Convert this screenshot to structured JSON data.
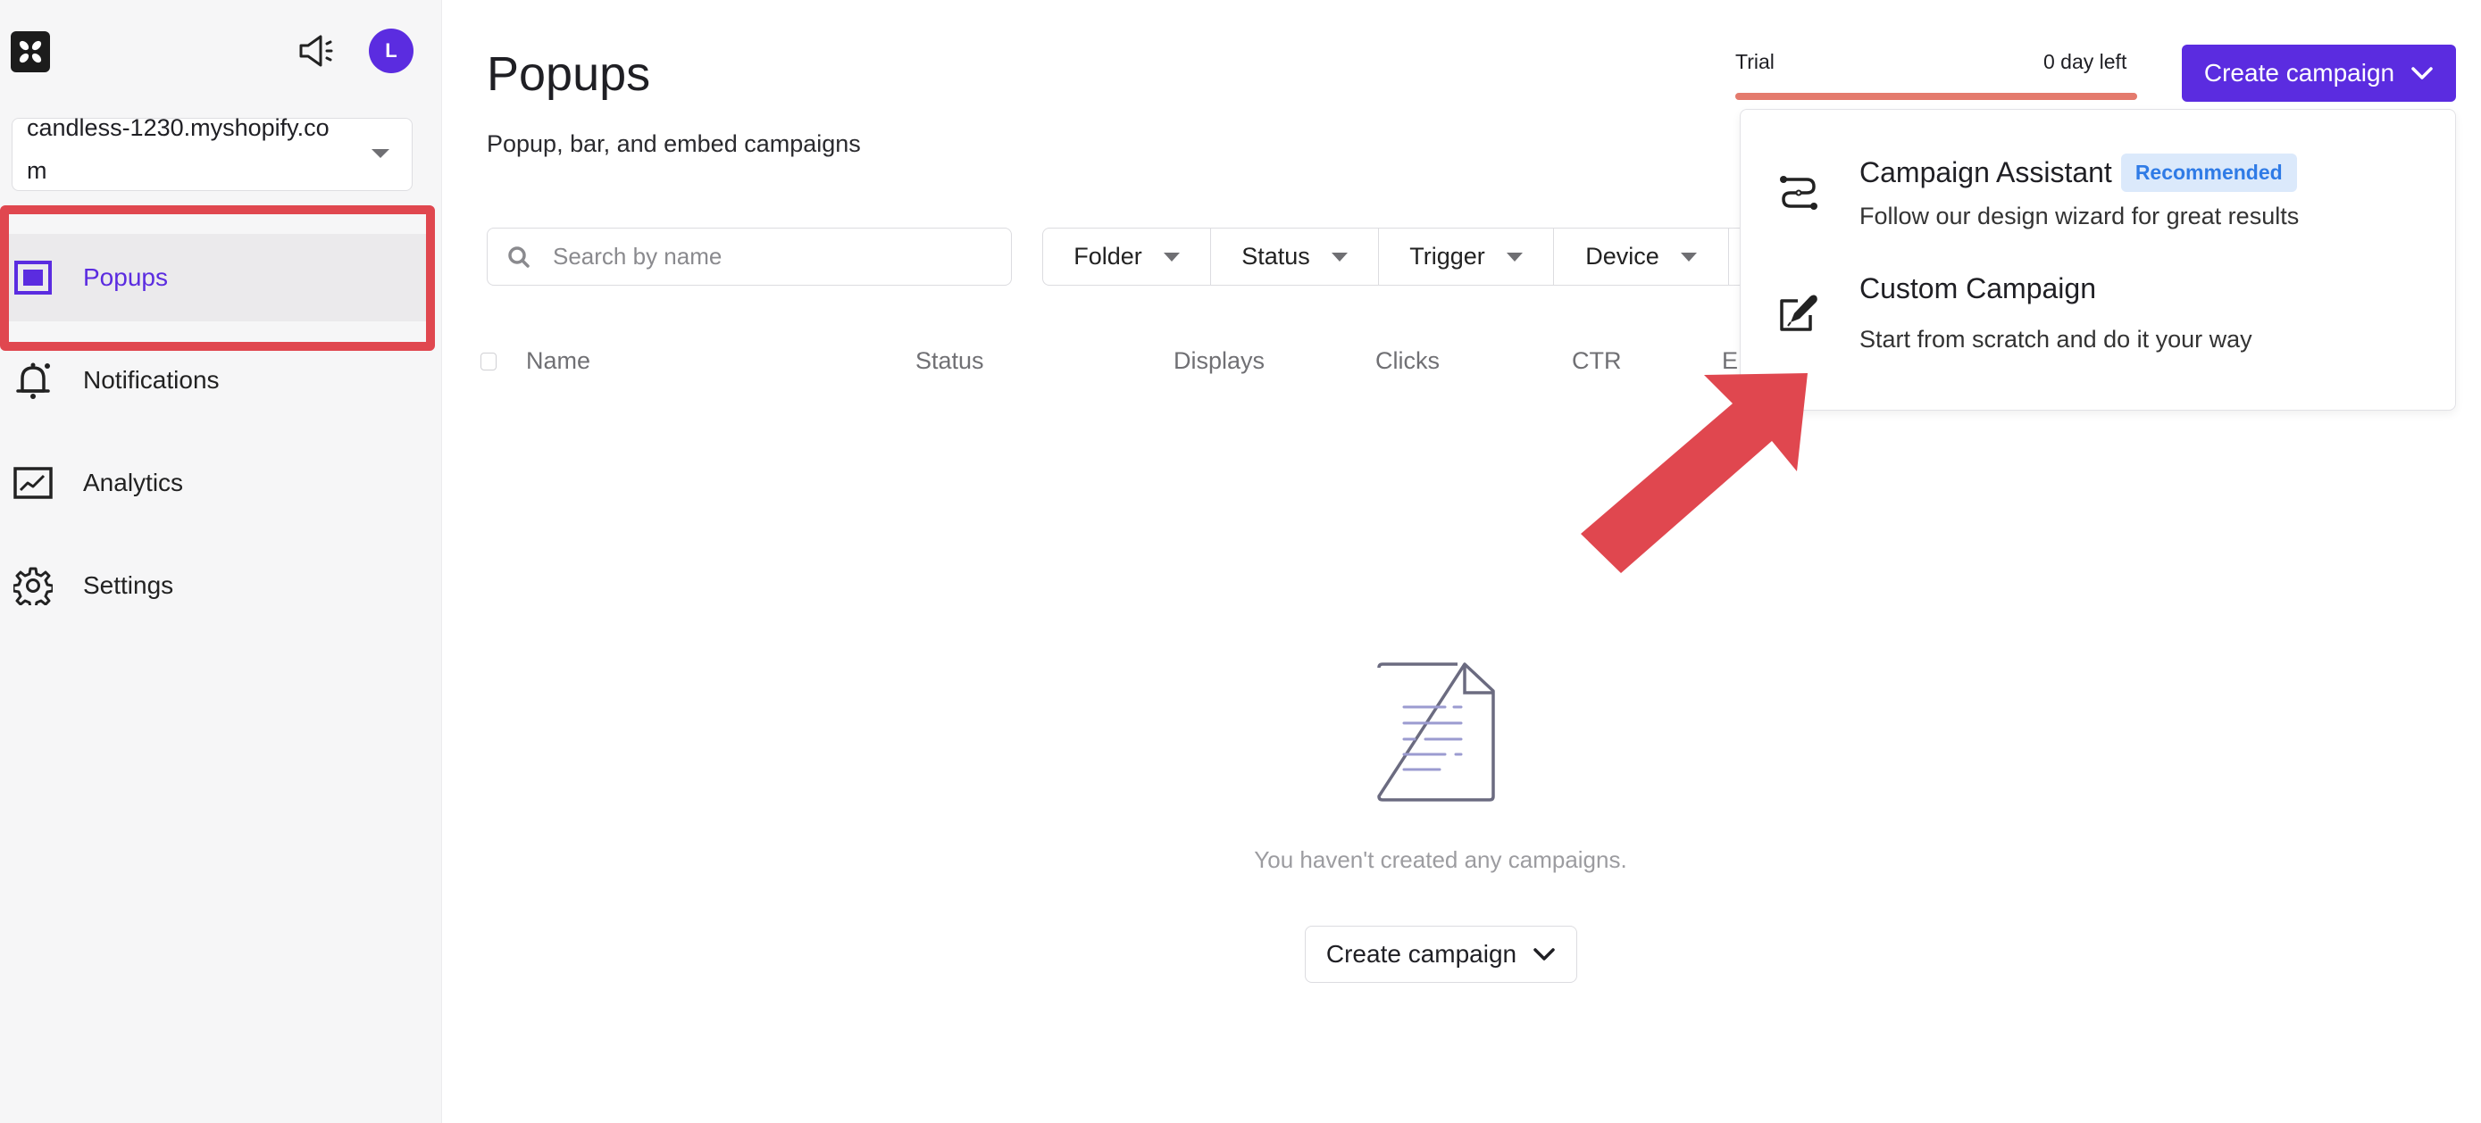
{
  "sidebar": {
    "logo_icon": "brand-logo-icon",
    "announcements_icon": "megaphone-icon",
    "avatar_initial": "L",
    "store_select": {
      "value": "candless-1230.myshopify.com",
      "icon": "caret-down-icon"
    },
    "items": [
      {
        "label": "Popups",
        "icon": "popup-window-icon",
        "active": true
      },
      {
        "label": "Notifications",
        "icon": "bell-icon",
        "active": false
      },
      {
        "label": "Analytics",
        "icon": "chart-line-icon",
        "active": false
      },
      {
        "label": "Settings",
        "icon": "gear-icon",
        "active": false
      }
    ]
  },
  "header": {
    "title": "Popups",
    "subtitle": "Popup, bar, and embed campaigns",
    "trial": {
      "label": "Trial",
      "remaining": "0 day left",
      "progress_fraction": 1.0
    },
    "create_button": {
      "label": "Create campaign",
      "icon": "chevron-down-icon"
    }
  },
  "toolbar": {
    "search": {
      "placeholder": "Search by name",
      "value": "",
      "icon": "search-icon"
    },
    "filters": [
      {
        "label": "Folder"
      },
      {
        "label": "Status"
      },
      {
        "label": "Trigger"
      },
      {
        "label": "Device"
      }
    ]
  },
  "table": {
    "columns": [
      "Name",
      "Status",
      "Displays",
      "Clicks",
      "CTR",
      "E"
    ]
  },
  "create_menu": {
    "items": [
      {
        "title": "Campaign Assistant",
        "badge": "Recommended",
        "description": "Follow our design wizard for great results",
        "icon": "wizard-path-icon"
      },
      {
        "title": "Custom Campaign",
        "badge": null,
        "description": "Start from scratch and do it your way",
        "icon": "edit-pen-icon"
      }
    ]
  },
  "empty_state": {
    "icon": "document-icon",
    "message": "You haven't created any campaigns.",
    "button_label": "Create campaign"
  },
  "colors": {
    "accent": "#5b2ce0",
    "annotation_red": "#e0474f",
    "trial_bar": "#e47a6d",
    "badge_bg": "#dbe9fb",
    "badge_text": "#2f7be6"
  }
}
